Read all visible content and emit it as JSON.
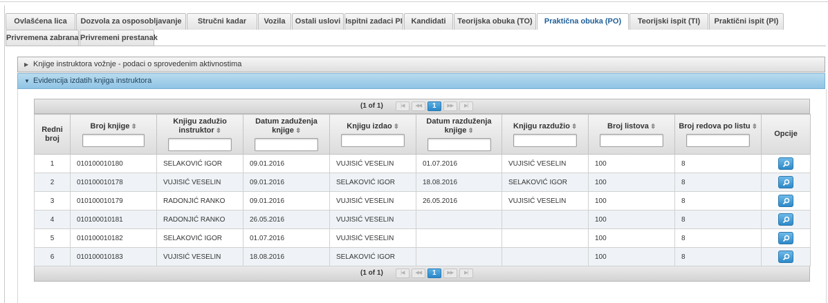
{
  "tabs": {
    "row1": [
      "Ovlašćena lica",
      "Dozvola za osposobljavanje",
      "Stručni kadar",
      "Vozila",
      "Ostali uslovi",
      "Ispitni zadaci PI",
      "Kandidati",
      "Teorijska obuka (TO)",
      "Praktična obuka (PO)",
      "Teorijski ispit (TI)",
      "Praktični ispit (PI)"
    ],
    "row2": [
      "Privremena zabrana",
      "Privremeni prestanak"
    ],
    "active": "Praktična obuka (PO)"
  },
  "accordion": {
    "section1": "Knjige instruktora vožnje - podaci o sprovedenim aktivnostima",
    "section2": "Evidencija izdatih knjiga instruktora"
  },
  "pager": {
    "info": "(1 of 1)",
    "current_page": "1",
    "first_icon": "first-page-icon",
    "prev_icon": "prev-page-icon",
    "next_icon": "next-page-icon",
    "last_icon": "last-page-icon"
  },
  "table": {
    "columns": [
      {
        "label": "Redni broj",
        "sortable": false,
        "filter": false
      },
      {
        "label": "Broj knjige",
        "sortable": true,
        "filter": true
      },
      {
        "label": "Knjigu zadužio instruktor",
        "sortable": true,
        "filter": true
      },
      {
        "label": "Datum zaduženja knjige",
        "sortable": true,
        "filter": true
      },
      {
        "label": "Knjigu izdao",
        "sortable": true,
        "filter": true
      },
      {
        "label": "Datum razduženja knjige",
        "sortable": true,
        "filter": true
      },
      {
        "label": "Knjigu razdužio",
        "sortable": true,
        "filter": true
      },
      {
        "label": "Broj listova",
        "sortable": true,
        "filter": true
      },
      {
        "label": "Broj redova po listu",
        "sortable": true,
        "filter": true
      },
      {
        "label": "Opcije",
        "sortable": false,
        "filter": false
      }
    ],
    "sort_icon": "sort-icon",
    "row_action_icon": "search-icon",
    "rows": [
      [
        "1",
        "010100010180",
        "SELAKOVIĆ IGOR",
        "09.01.2016",
        "VUJISIĆ VESELIN",
        "01.07.2016",
        "VUJISIĆ VESELIN",
        "100",
        "8"
      ],
      [
        "2",
        "010100010178",
        "VUJISIĆ VESELIN",
        "09.01.2016",
        "SELAKOVIĆ IGOR",
        "18.08.2016",
        "SELAKOVIĆ IGOR",
        "100",
        "8"
      ],
      [
        "3",
        "010100010179",
        "RADONJIĆ RANKO",
        "09.01.2016",
        "VUJISIĆ VESELIN",
        "26.05.2016",
        "VUJISIĆ VESELIN",
        "100",
        "8"
      ],
      [
        "4",
        "010100010181",
        "RADONJIĆ RANKO",
        "26.05.2016",
        "VUJISIĆ VESELIN",
        "",
        "",
        "100",
        "8"
      ],
      [
        "5",
        "010100010182",
        "SELAKOVIĆ IGOR",
        "01.07.2016",
        "VUJISIĆ VESELIN",
        "",
        "",
        "100",
        "8"
      ],
      [
        "6",
        "010100010183",
        "VUJISIĆ VESELIN",
        "18.08.2016",
        "SELAKOVIĆ IGOR",
        "",
        "",
        "100",
        "8"
      ]
    ]
  },
  "colors": {
    "active_tab_text": "#1f5f98",
    "accordion_active": "#9fcbe8",
    "button_blue": "#2e89c8",
    "row_alt": "#eff3f7"
  }
}
